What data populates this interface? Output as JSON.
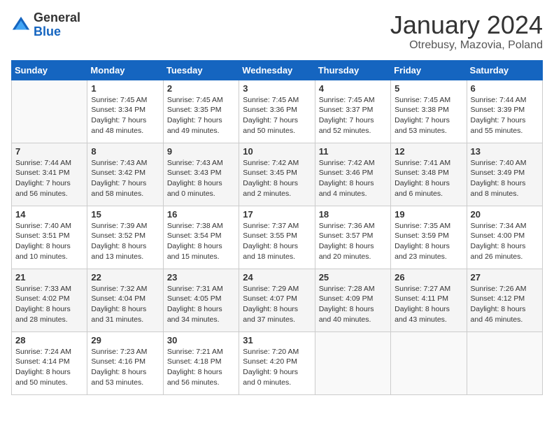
{
  "logo": {
    "general": "General",
    "blue": "Blue"
  },
  "title": "January 2024",
  "subtitle": "Otrebusy, Mazovia, Poland",
  "header_days": [
    "Sunday",
    "Monday",
    "Tuesday",
    "Wednesday",
    "Thursday",
    "Friday",
    "Saturday"
  ],
  "weeks": [
    [
      {
        "day": "",
        "sunrise": "",
        "sunset": "",
        "daylight": ""
      },
      {
        "day": "1",
        "sunrise": "Sunrise: 7:45 AM",
        "sunset": "Sunset: 3:34 PM",
        "daylight": "Daylight: 7 hours and 48 minutes."
      },
      {
        "day": "2",
        "sunrise": "Sunrise: 7:45 AM",
        "sunset": "Sunset: 3:35 PM",
        "daylight": "Daylight: 7 hours and 49 minutes."
      },
      {
        "day": "3",
        "sunrise": "Sunrise: 7:45 AM",
        "sunset": "Sunset: 3:36 PM",
        "daylight": "Daylight: 7 hours and 50 minutes."
      },
      {
        "day": "4",
        "sunrise": "Sunrise: 7:45 AM",
        "sunset": "Sunset: 3:37 PM",
        "daylight": "Daylight: 7 hours and 52 minutes."
      },
      {
        "day": "5",
        "sunrise": "Sunrise: 7:45 AM",
        "sunset": "Sunset: 3:38 PM",
        "daylight": "Daylight: 7 hours and 53 minutes."
      },
      {
        "day": "6",
        "sunrise": "Sunrise: 7:44 AM",
        "sunset": "Sunset: 3:39 PM",
        "daylight": "Daylight: 7 hours and 55 minutes."
      }
    ],
    [
      {
        "day": "7",
        "sunrise": "Sunrise: 7:44 AM",
        "sunset": "Sunset: 3:41 PM",
        "daylight": "Daylight: 7 hours and 56 minutes."
      },
      {
        "day": "8",
        "sunrise": "Sunrise: 7:43 AM",
        "sunset": "Sunset: 3:42 PM",
        "daylight": "Daylight: 7 hours and 58 minutes."
      },
      {
        "day": "9",
        "sunrise": "Sunrise: 7:43 AM",
        "sunset": "Sunset: 3:43 PM",
        "daylight": "Daylight: 8 hours and 0 minutes."
      },
      {
        "day": "10",
        "sunrise": "Sunrise: 7:42 AM",
        "sunset": "Sunset: 3:45 PM",
        "daylight": "Daylight: 8 hours and 2 minutes."
      },
      {
        "day": "11",
        "sunrise": "Sunrise: 7:42 AM",
        "sunset": "Sunset: 3:46 PM",
        "daylight": "Daylight: 8 hours and 4 minutes."
      },
      {
        "day": "12",
        "sunrise": "Sunrise: 7:41 AM",
        "sunset": "Sunset: 3:48 PM",
        "daylight": "Daylight: 8 hours and 6 minutes."
      },
      {
        "day": "13",
        "sunrise": "Sunrise: 7:40 AM",
        "sunset": "Sunset: 3:49 PM",
        "daylight": "Daylight: 8 hours and 8 minutes."
      }
    ],
    [
      {
        "day": "14",
        "sunrise": "Sunrise: 7:40 AM",
        "sunset": "Sunset: 3:51 PM",
        "daylight": "Daylight: 8 hours and 10 minutes."
      },
      {
        "day": "15",
        "sunrise": "Sunrise: 7:39 AM",
        "sunset": "Sunset: 3:52 PM",
        "daylight": "Daylight: 8 hours and 13 minutes."
      },
      {
        "day": "16",
        "sunrise": "Sunrise: 7:38 AM",
        "sunset": "Sunset: 3:54 PM",
        "daylight": "Daylight: 8 hours and 15 minutes."
      },
      {
        "day": "17",
        "sunrise": "Sunrise: 7:37 AM",
        "sunset": "Sunset: 3:55 PM",
        "daylight": "Daylight: 8 hours and 18 minutes."
      },
      {
        "day": "18",
        "sunrise": "Sunrise: 7:36 AM",
        "sunset": "Sunset: 3:57 PM",
        "daylight": "Daylight: 8 hours and 20 minutes."
      },
      {
        "day": "19",
        "sunrise": "Sunrise: 7:35 AM",
        "sunset": "Sunset: 3:59 PM",
        "daylight": "Daylight: 8 hours and 23 minutes."
      },
      {
        "day": "20",
        "sunrise": "Sunrise: 7:34 AM",
        "sunset": "Sunset: 4:00 PM",
        "daylight": "Daylight: 8 hours and 26 minutes."
      }
    ],
    [
      {
        "day": "21",
        "sunrise": "Sunrise: 7:33 AM",
        "sunset": "Sunset: 4:02 PM",
        "daylight": "Daylight: 8 hours and 28 minutes."
      },
      {
        "day": "22",
        "sunrise": "Sunrise: 7:32 AM",
        "sunset": "Sunset: 4:04 PM",
        "daylight": "Daylight: 8 hours and 31 minutes."
      },
      {
        "day": "23",
        "sunrise": "Sunrise: 7:31 AM",
        "sunset": "Sunset: 4:05 PM",
        "daylight": "Daylight: 8 hours and 34 minutes."
      },
      {
        "day": "24",
        "sunrise": "Sunrise: 7:29 AM",
        "sunset": "Sunset: 4:07 PM",
        "daylight": "Daylight: 8 hours and 37 minutes."
      },
      {
        "day": "25",
        "sunrise": "Sunrise: 7:28 AM",
        "sunset": "Sunset: 4:09 PM",
        "daylight": "Daylight: 8 hours and 40 minutes."
      },
      {
        "day": "26",
        "sunrise": "Sunrise: 7:27 AM",
        "sunset": "Sunset: 4:11 PM",
        "daylight": "Daylight: 8 hours and 43 minutes."
      },
      {
        "day": "27",
        "sunrise": "Sunrise: 7:26 AM",
        "sunset": "Sunset: 4:12 PM",
        "daylight": "Daylight: 8 hours and 46 minutes."
      }
    ],
    [
      {
        "day": "28",
        "sunrise": "Sunrise: 7:24 AM",
        "sunset": "Sunset: 4:14 PM",
        "daylight": "Daylight: 8 hours and 50 minutes."
      },
      {
        "day": "29",
        "sunrise": "Sunrise: 7:23 AM",
        "sunset": "Sunset: 4:16 PM",
        "daylight": "Daylight: 8 hours and 53 minutes."
      },
      {
        "day": "30",
        "sunrise": "Sunrise: 7:21 AM",
        "sunset": "Sunset: 4:18 PM",
        "daylight": "Daylight: 8 hours and 56 minutes."
      },
      {
        "day": "31",
        "sunrise": "Sunrise: 7:20 AM",
        "sunset": "Sunset: 4:20 PM",
        "daylight": "Daylight: 9 hours and 0 minutes."
      },
      {
        "day": "",
        "sunrise": "",
        "sunset": "",
        "daylight": ""
      },
      {
        "day": "",
        "sunrise": "",
        "sunset": "",
        "daylight": ""
      },
      {
        "day": "",
        "sunrise": "",
        "sunset": "",
        "daylight": ""
      }
    ]
  ]
}
